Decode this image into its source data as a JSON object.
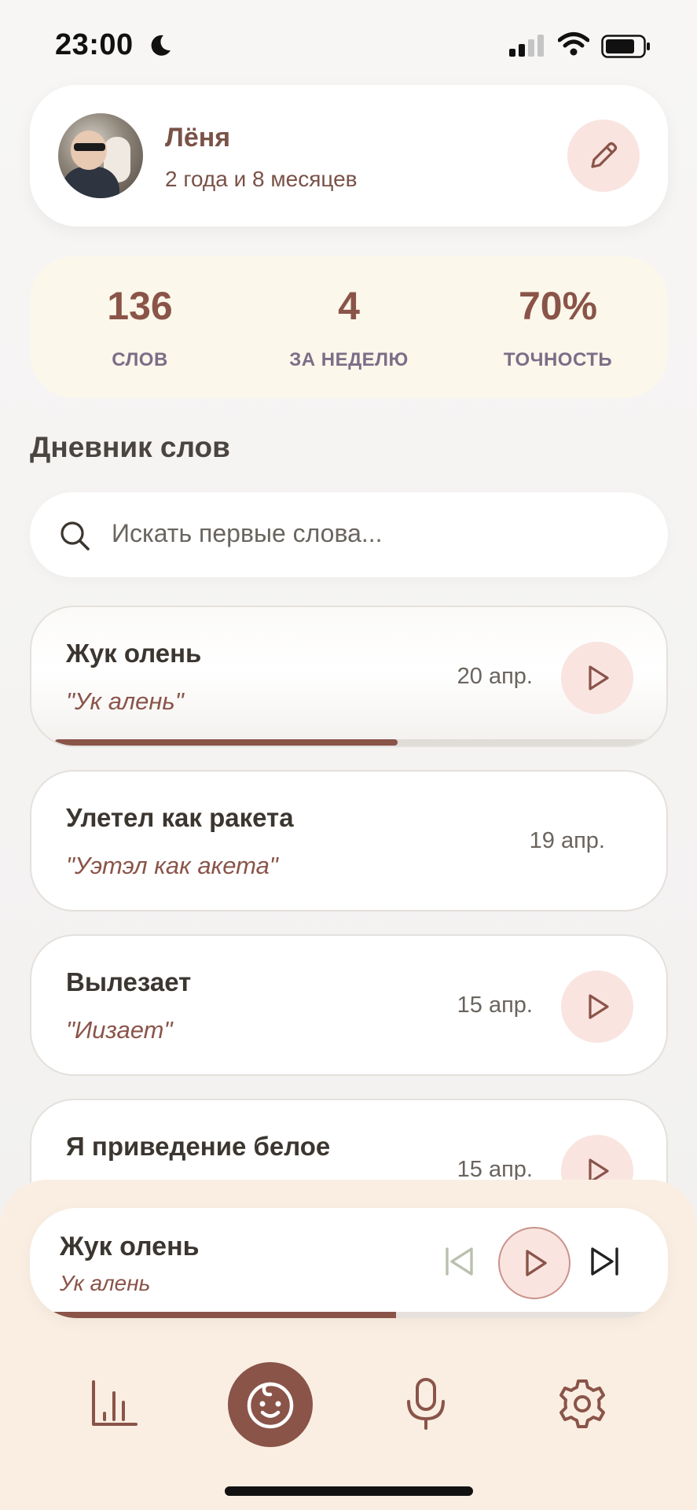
{
  "status_bar": {
    "time": "23:00"
  },
  "profile": {
    "name": "Лёня",
    "age": "2 года и 8 месяцев"
  },
  "stats": [
    {
      "value": "136",
      "label": "СЛОВ"
    },
    {
      "value": "4",
      "label": "ЗА НЕДЕЛЮ"
    },
    {
      "value": "70%",
      "label": "ТОЧНОСТЬ"
    }
  ],
  "diary": {
    "title": "Дневник слов",
    "search_placeholder": "Искать первые слова...",
    "words": [
      {
        "title": "Жук олень",
        "quote": "\"Ук алень\"",
        "date": "20 апр.",
        "has_audio": true,
        "playing": true,
        "progress": 0.58
      },
      {
        "title": "Улетел как ракета",
        "quote": "\"Уэтэл как акета\"",
        "date": "19 апр.",
        "has_audio": false
      },
      {
        "title": "Вылезает",
        "quote": "\"Иизает\"",
        "date": "15 апр.",
        "has_audio": true
      },
      {
        "title": "Я приведение белое",
        "quote": "",
        "date": "15 апр.",
        "has_audio": true
      }
    ]
  },
  "player": {
    "title": "Жук олень",
    "subtitle": "Ук алень",
    "progress": 0.58
  },
  "tabs": [
    {
      "icon": "chart-bars-icon",
      "active": false
    },
    {
      "icon": "baby-face-icon",
      "active": true
    },
    {
      "icon": "microphone-icon",
      "active": false
    },
    {
      "icon": "gear-icon",
      "active": false
    }
  ],
  "colors": {
    "accent": "#8a5449",
    "accent_light": "#f9e4e0",
    "stats_bg": "#fbf7ea",
    "bottom_bg": "#faeee2"
  }
}
